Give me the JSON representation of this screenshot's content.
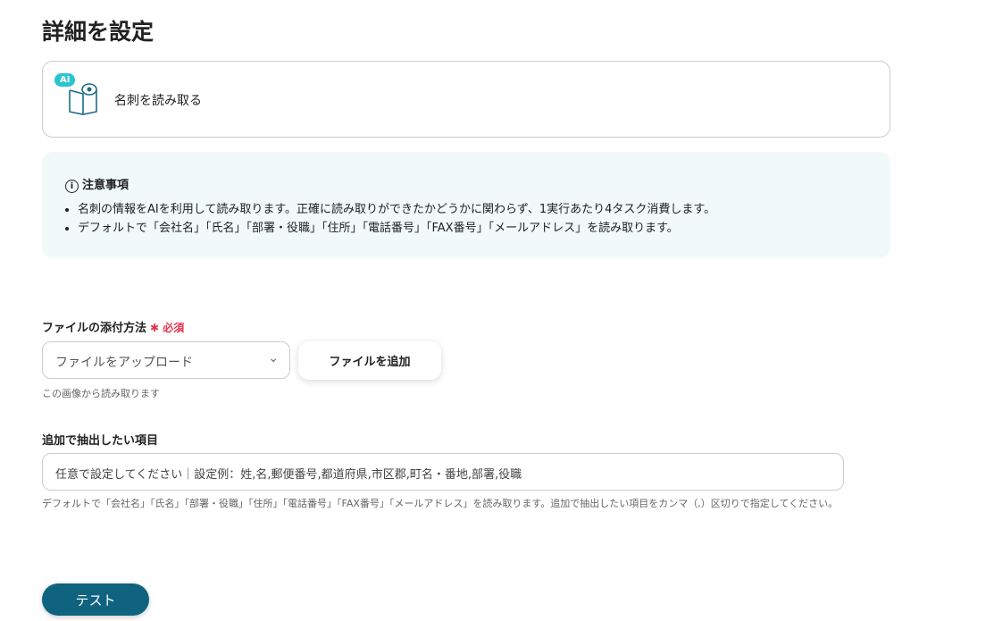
{
  "title": "詳細を設定",
  "action": {
    "badge": "AI",
    "label": "名刺を読み取る"
  },
  "notice": {
    "title": "注意事項",
    "items": [
      "名刺の情報をAIを利用して読み取ります。正確に読み取りができたかどうかに関わらず、1実行あたり4タスク消費します。",
      "デフォルトで「会社名」「氏名」「部署・役職」「住所」「電話番号」「FAX番号」「メールアドレス」を読み取ります。"
    ]
  },
  "file": {
    "label": "ファイルの添付方法",
    "required": "必須",
    "select_value": "ファイルをアップロード",
    "add_button": "ファイルを追加",
    "hint": "この画像から読み取ります"
  },
  "extra": {
    "label": "追加で抽出したい項目",
    "placeholder": "任意で設定してください｜設定例：姓,名,郵便番号,都道府県,市区郡,町名・番地,部署,役職",
    "hint": "デフォルトで「会社名」「氏名」「部署・役職」「住所」「電話番号」「FAX番号」「メールアドレス」を読み取ります。追加で抽出したい項目をカンマ（,）区切りで指定してください。"
  },
  "test_button": "テスト"
}
